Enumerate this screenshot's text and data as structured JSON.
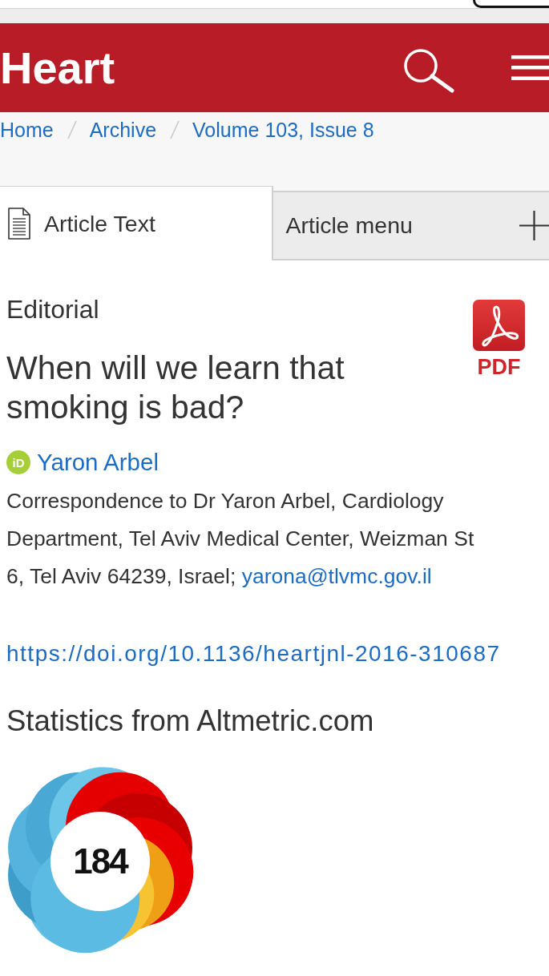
{
  "header": {
    "logo": "Heart"
  },
  "breadcrumbs": [
    {
      "label": "Home"
    },
    {
      "label": "Archive"
    },
    {
      "label": "Volume 103, Issue 8"
    }
  ],
  "tabs": [
    {
      "label": "Article Text",
      "kind": "document",
      "selected": true
    },
    {
      "label": "Article menu",
      "kind": "expand",
      "selected": false
    }
  ],
  "article": {
    "category": "Editorial",
    "pdf_label": "PDF",
    "title": "When will we learn that smoking is bad?",
    "author": {
      "orcid_badge": "iD",
      "name": "Yaron Arbel"
    },
    "correspondence": {
      "text": "Correspondence to Dr Yaron Arbel, Cardiology Department, Tel Aviv Medical Center, Weizman St 6, Tel Aviv 64239, Israel;",
      "email": "yarona@tlvmc.gov.il"
    },
    "doi": "https://doi.org/10.1136/heartjnl-2016-310687"
  },
  "altmetric": {
    "heading": "Statistics from Altmetric.com",
    "score": "184"
  }
}
